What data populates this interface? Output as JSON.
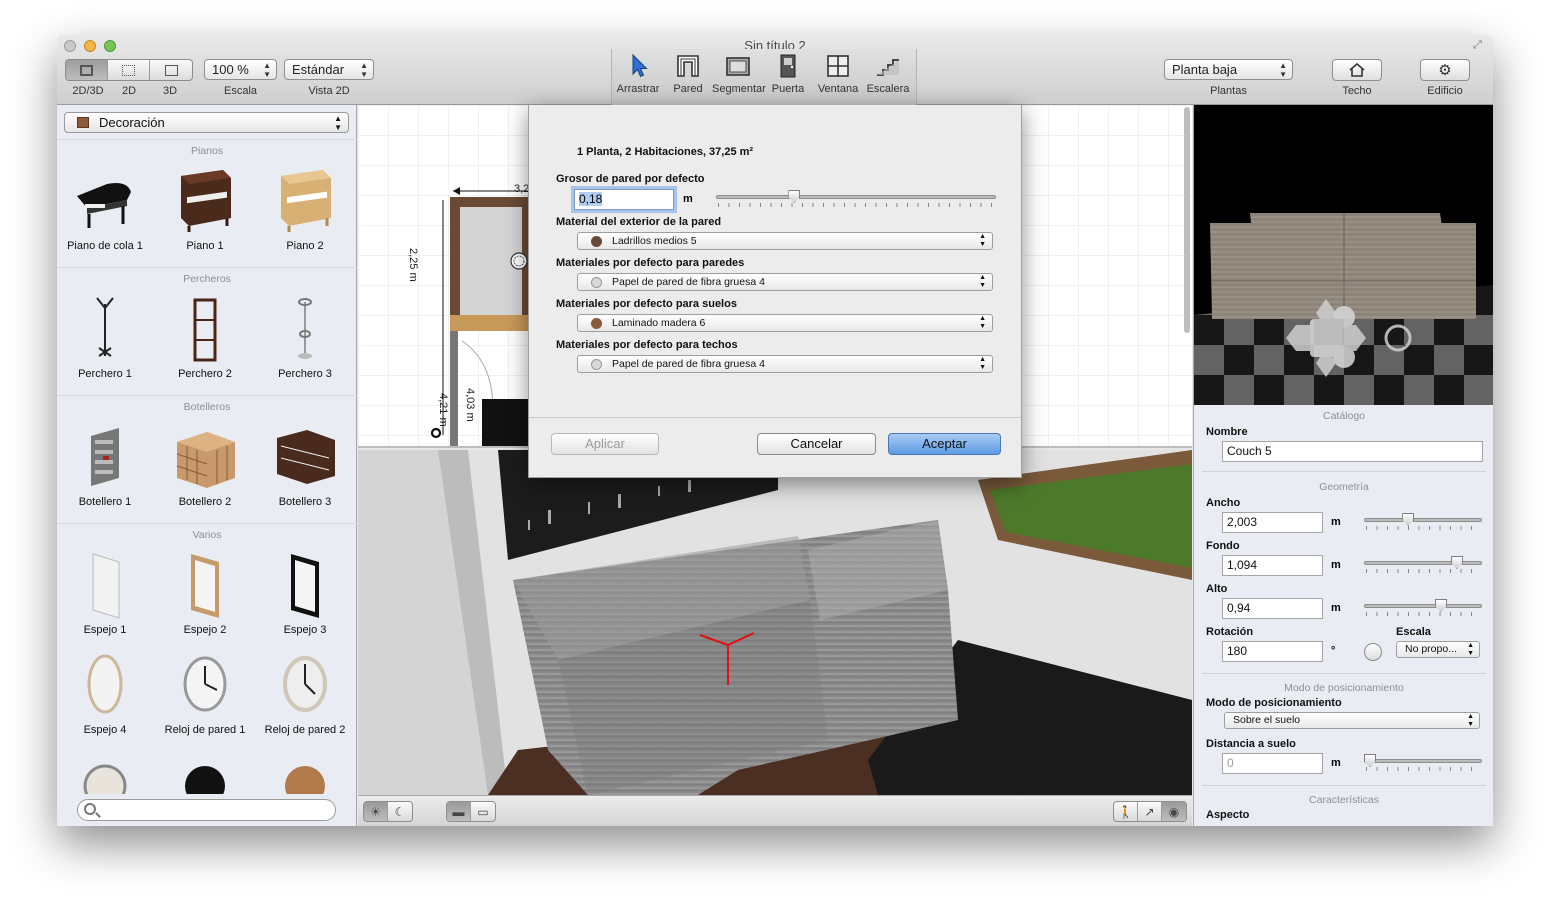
{
  "window": {
    "title": "Sin título 2"
  },
  "toolbar": {
    "view_mode_labels": [
      "2D/3D",
      "2D",
      "3D"
    ],
    "zoom_value": "100 %",
    "zoom_label": "Escala",
    "view2d_value": "Estándar",
    "view2d_label": "Vista 2D",
    "tools": [
      "Arrastrar",
      "Pared",
      "Segmentar",
      "Puerta",
      "Ventana",
      "Escalera"
    ],
    "level_value": "Planta baja",
    "level_label": "Plantas",
    "roof_label": "Techo",
    "building_label": "Edificio"
  },
  "catalog": {
    "category": "Decoración",
    "sections": [
      {
        "title": "Pianos",
        "items": [
          "Piano de cola 1",
          "Piano 1",
          "Piano 2"
        ]
      },
      {
        "title": "Percheros",
        "items": [
          "Perchero 1",
          "Perchero 2",
          "Perchero 3"
        ]
      },
      {
        "title": "Botelleros",
        "items": [
          "Botellero 1",
          "Botellero 2",
          "Botellero 3"
        ]
      },
      {
        "title": "Varios",
        "items": [
          "Espejo 1",
          "Espejo 2",
          "Espejo 3",
          "Espejo 4",
          "Reloj de pared 1",
          "Reloj de pared 2"
        ]
      }
    ],
    "search_placeholder": ""
  },
  "plan": {
    "dim_top": "3,2",
    "dim_left_1": "2,25 m",
    "dim_left_2": "4,21 m",
    "dim_inner": "4,03 m"
  },
  "dialog": {
    "summary": "1 Planta, 2 Habitaciones, 37,25 m²",
    "wall_thickness_label": "Grosor de pared por defecto",
    "wall_thickness_value": "0,18",
    "wall_thickness_unit": "m",
    "wall_thickness_slider": 0.27,
    "exterior_label": "Material del exterior de la pared",
    "exterior_value": "Ladrillos medios 5",
    "walls_label": "Materiales por defecto para paredes",
    "walls_value": "Papel de pared de fibra gruesa 4",
    "floors_label": "Materiales por defecto para suelos",
    "floors_value": "Laminado madera 6",
    "ceilings_label": "Materiales por defecto para techos",
    "ceilings_value": "Papel de pared de fibra gruesa 4",
    "apply_label": "Aplicar",
    "cancel_label": "Cancelar",
    "ok_label": "Aceptar",
    "colors": {
      "brick": "#6a4a3a",
      "paper": "#d8d8d8",
      "wood": "#8a5a3a"
    }
  },
  "properties": {
    "catalog_section": "Catálogo",
    "name_label": "Nombre",
    "name_value": "Couch 5",
    "geometry_section": "Geometría",
    "width_label": "Ancho",
    "width_value": "2,003",
    "width_slider": 0.36,
    "depth_label": "Fondo",
    "depth_value": "1,094",
    "depth_slider": 0.82,
    "height_label": "Alto",
    "height_value": "0,94",
    "height_slider": 0.67,
    "unit": "m",
    "rotation_label": "Rotación",
    "rotation_value": "180",
    "rotation_unit": "°",
    "scale_label": "Escala",
    "scale_value": "No propo...",
    "positioning_section": "Modo de posicionamiento",
    "positioning_label": "Modo de posicionamiento",
    "positioning_value": "Sobre el suelo",
    "elevation_label": "Distancia a suelo",
    "elevation_placeholder": "0",
    "elevation_slider": 0.0,
    "features_section": "Características",
    "appearance_label": "Aspecto"
  }
}
